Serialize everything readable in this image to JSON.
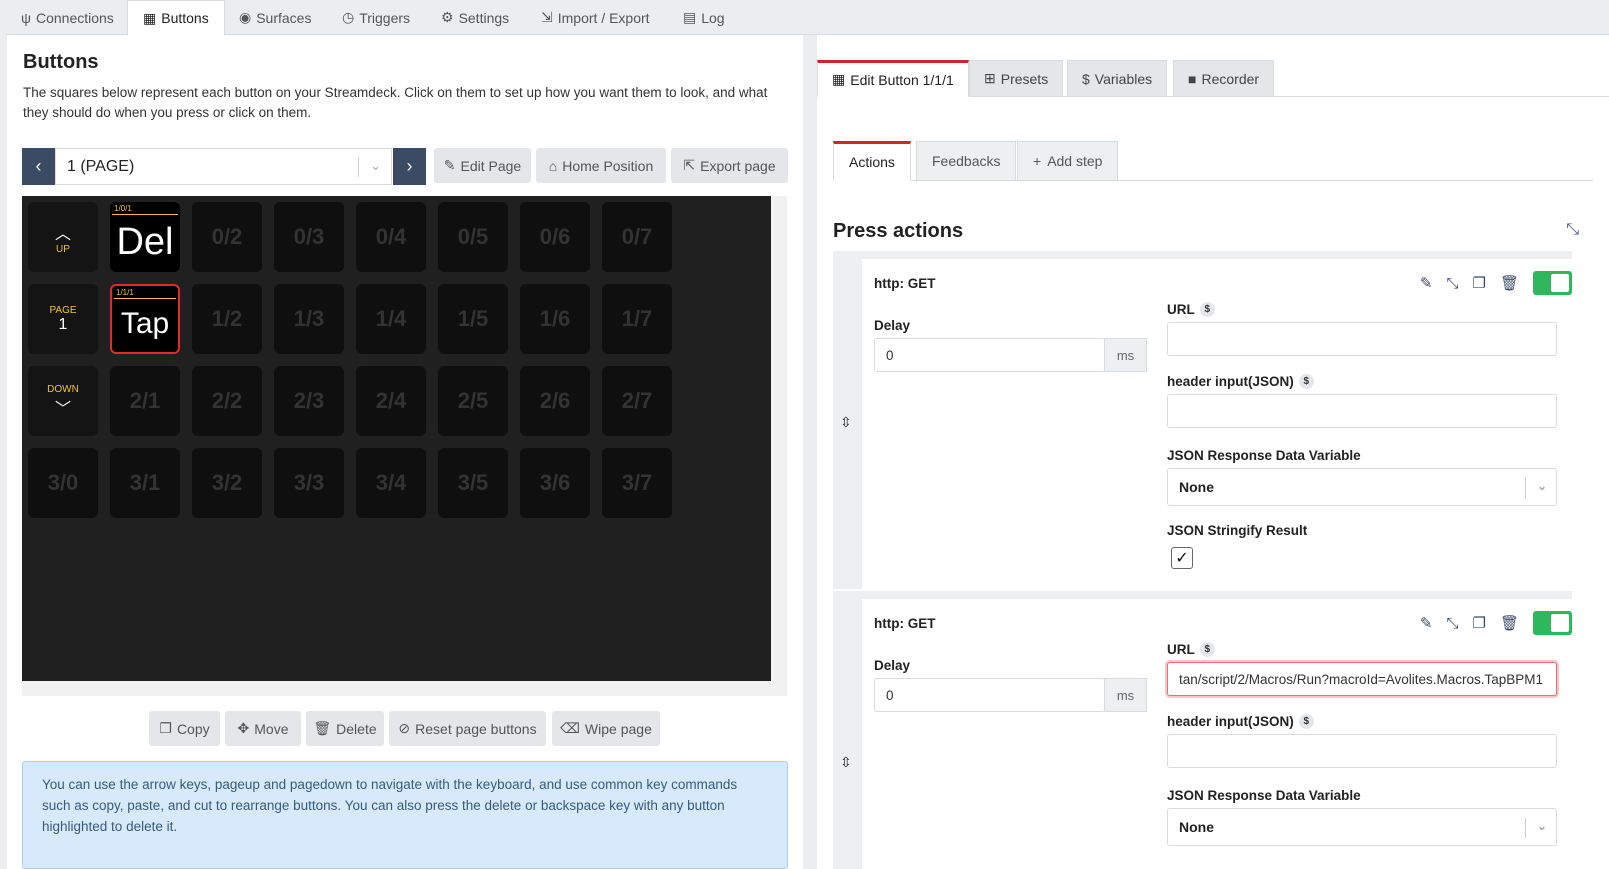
{
  "topnav": {
    "tabs": [
      {
        "label": "Connections",
        "icon": "plug-icon"
      },
      {
        "label": "Buttons",
        "icon": "calculator-icon"
      },
      {
        "label": "Surfaces",
        "icon": "gamepad-icon"
      },
      {
        "label": "Triggers",
        "icon": "clock-icon"
      },
      {
        "label": "Settings",
        "icon": "cog-icon"
      },
      {
        "label": "Import / Export",
        "icon": "file-import-icon"
      },
      {
        "label": "Log",
        "icon": "clipboard-icon"
      }
    ],
    "active": "Buttons"
  },
  "left": {
    "title": "Buttons",
    "description": "The squares below represent each button on your Streamdeck. Click on them to set up how you want them to look, and what they should do when you press or click on them.",
    "page_select": "1 (PAGE)",
    "toolbar": {
      "edit_page": "Edit Page",
      "home_position": "Home Position",
      "export_page": "Export page"
    },
    "grid": {
      "up_label": "UP",
      "page_label": "PAGE",
      "page_number": "1",
      "down_label": "DOWN",
      "del_loc": "1/0/1",
      "del_text": "Del",
      "tap_loc": "1/1/1",
      "tap_text": "Tap",
      "row0": [
        "0/2",
        "0/3",
        "0/4",
        "0/5",
        "0/6",
        "0/7"
      ],
      "row1": [
        "1/2",
        "1/3",
        "1/4",
        "1/5",
        "1/6",
        "1/7"
      ],
      "row2": [
        "2/1",
        "2/2",
        "2/3",
        "2/4",
        "2/5",
        "2/6",
        "2/7"
      ],
      "row3": [
        "3/0",
        "3/1",
        "3/2",
        "3/3",
        "3/4",
        "3/5",
        "3/6",
        "3/7"
      ]
    },
    "bottom_buttons": {
      "copy": "Copy",
      "move": "Move",
      "delete": "Delete",
      "reset": "Reset page buttons",
      "wipe": "Wipe page"
    },
    "info": "You can use the arrow keys, pageup and pagedown to navigate with the keyboard, and use common key commands such as copy, paste, and cut to rearrange buttons. You can also press the delete or backspace key with any button highlighted to delete it."
  },
  "right": {
    "tabs": {
      "edit": "Edit Button 1/1/1",
      "presets": "Presets",
      "variables": "Variables",
      "recorder": "Recorder"
    },
    "subtabs": {
      "actions": "Actions",
      "feedbacks": "Feedbacks",
      "add_step": "Add step"
    },
    "section_title": "Press actions",
    "actions": [
      {
        "title": "http: GET",
        "delay_label": "Delay",
        "delay_value": "0",
        "delay_unit": "ms",
        "url_label": "URL",
        "url_value": "",
        "header_label": "header input(JSON)",
        "header_value": "",
        "json_var_label": "JSON Response Data Variable",
        "json_var_value": "None",
        "stringify_label": "JSON Stringify Result",
        "stringify_checked": true
      },
      {
        "title": "http: GET",
        "delay_label": "Delay",
        "delay_value": "0",
        "delay_unit": "ms",
        "url_label": "URL",
        "url_value": "tan/script/2/Macros/Run?macroId=Avolites.Macros.TapBPM1",
        "header_label": "header input(JSON)",
        "header_value": "",
        "json_var_label": "JSON Response Data Variable",
        "json_var_value": "None"
      }
    ]
  },
  "colors": {
    "accent_red": "#d1232a",
    "toggle_green": "#2eb85c",
    "nav_dark": "#3c4b64",
    "info_blue": "#d6eafc"
  }
}
